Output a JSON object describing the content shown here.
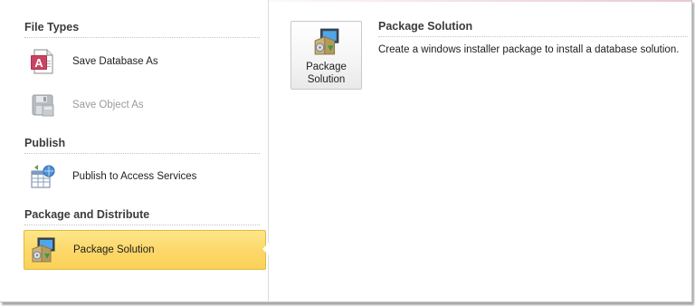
{
  "sections": [
    {
      "title": "File Types",
      "items": [
        {
          "label": "Save Database As",
          "icon": "access-database-icon",
          "enabled": true
        },
        {
          "label": "Save Object As",
          "icon": "save-object-icon",
          "enabled": false
        }
      ]
    },
    {
      "title": "Publish",
      "items": [
        {
          "label": "Publish to Access Services",
          "icon": "publish-services-icon",
          "enabled": true
        }
      ]
    },
    {
      "title": "Package and Distribute",
      "items": [
        {
          "label": "Package Solution",
          "icon": "package-installer-icon",
          "enabled": true,
          "selected": true
        }
      ]
    }
  ],
  "detail": {
    "button_line1": "Package",
    "button_line2": "Solution",
    "title": "Package Solution",
    "description": "Create a windows installer package to install a database solution."
  },
  "colors": {
    "selection": "#fcd86a",
    "selection_border": "#e3b93a",
    "section_title": "#3c3c3c",
    "disabled_text": "#9a9a9a",
    "access_red": "#a4373a"
  }
}
